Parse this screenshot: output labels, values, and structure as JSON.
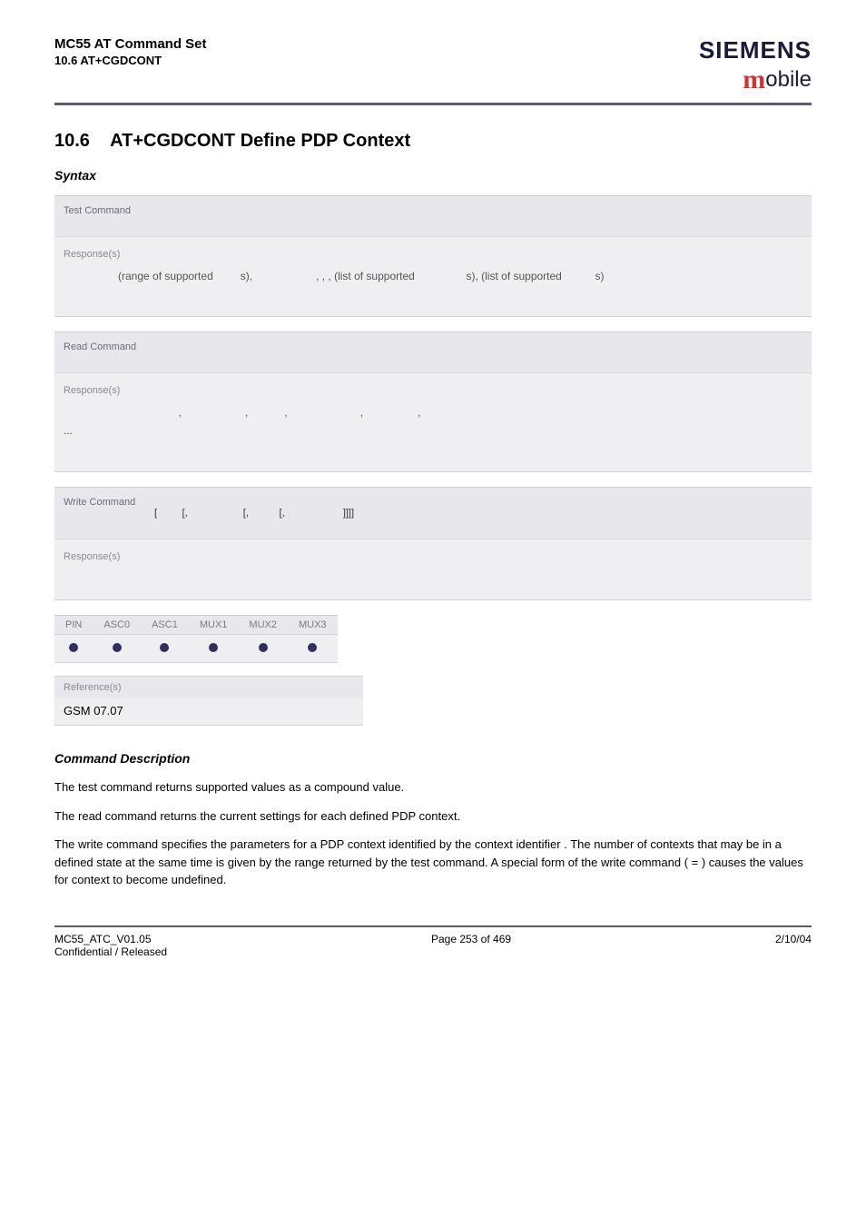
{
  "header": {
    "titleLine1": "MC55 AT Command Set",
    "titleLine2": "10.6 AT+CGDCONT",
    "brand": "SIEMENS",
    "mobileM": "m",
    "mobileRest": "obile"
  },
  "section": {
    "number": "10.6",
    "title": "AT+CGDCONT   Define PDP Context"
  },
  "syntaxLabel": "Syntax",
  "panels": {
    "test": {
      "head": "Test Command",
      "respLabel": "Response(s)",
      "body": "(range of supported         s),                     , , , (list of supported                 s), (list of supported           s)"
    },
    "read": {
      "head": "Read Command",
      "respLabel": "Response(s)",
      "body": "                    ,                     ,            ,                        ,                  ,",
      "body2": "..."
    },
    "write": {
      "head": "Write Command",
      "headBody": "[         [,                    [,           [,                     ]]]]",
      "respLabel": "Response(s)"
    }
  },
  "supportTable": {
    "headers": [
      "PIN",
      "ASC0",
      "ASC1",
      "MUX1",
      "MUX2",
      "MUX3"
    ]
  },
  "reference": {
    "head": "Reference(s)",
    "body": "GSM 07.07"
  },
  "cmdDescLabel": "Command Description",
  "paragraphs": {
    "p1": "The test command returns supported values as a compound value.",
    "p2": "The read command returns the current settings for each defined PDP context.",
    "p3": "The write command specifies the parameters for a PDP context identified by the context identifier          . The number of contexts that may be in a defined state at the same time is given by the range returned by the test command. A special form of the write command (                    =         ) causes the values for context            to become undefined."
  },
  "footer": {
    "leftLine1": "MC55_ATC_V01.05",
    "leftLine2": "Confidential / Released",
    "center": "Page 253 of 469",
    "right": "2/10/04"
  }
}
